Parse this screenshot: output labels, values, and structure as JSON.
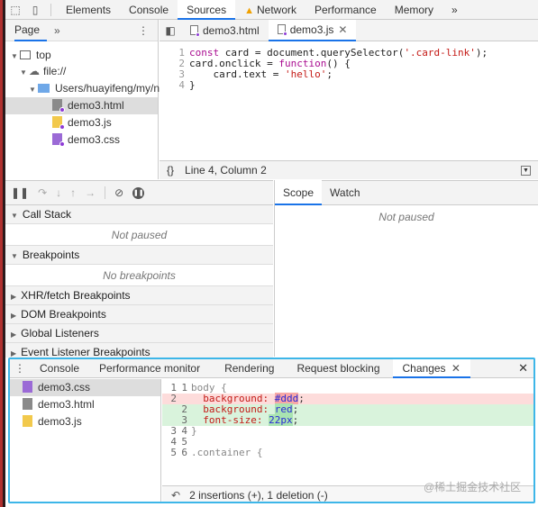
{
  "toolbar": {
    "tabs": [
      {
        "label": "Elements",
        "active": false
      },
      {
        "label": "Console",
        "active": false
      },
      {
        "label": "Sources",
        "active": true
      },
      {
        "label": "Network",
        "active": false,
        "warning": true
      },
      {
        "label": "Performance",
        "active": false
      },
      {
        "label": "Memory",
        "active": false
      }
    ],
    "more": "»"
  },
  "navigator": {
    "tab": "Page",
    "more": "»",
    "tree": {
      "top": "top",
      "origin": "file://",
      "folder": "Users/huayifeng/my/n",
      "files": [
        "demo3.html",
        "demo3.js",
        "demo3.css"
      ]
    }
  },
  "editor": {
    "tabs": [
      {
        "label": "demo3.html",
        "active": false
      },
      {
        "label": "demo3.js",
        "active": true
      }
    ],
    "lines": [
      "1",
      "2",
      "3",
      "4"
    ],
    "status": "Line 4, Column 2",
    "braces": "{}"
  },
  "code": {
    "l1_kw": "const",
    "l1_a": " card = document.querySelector(",
    "l1_str": "'.card-link'",
    "l1_b": ");",
    "l2_a": "card.onclick = ",
    "l2_kw": "function",
    "l2_b": "() {",
    "l3_a": "    card.text = ",
    "l3_str": "'hello'",
    "l3_b": ";",
    "l4": "}"
  },
  "debugger": {
    "call_stack": {
      "title": "Call Stack",
      "body": "Not paused"
    },
    "breakpoints": {
      "title": "Breakpoints",
      "body": "No breakpoints"
    },
    "xhr": "XHR/fetch Breakpoints",
    "dom": "DOM Breakpoints",
    "global": "Global Listeners",
    "event": "Event Listener Breakpoints",
    "scope_tabs": [
      "Scope",
      "Watch"
    ],
    "scope_body": "Not paused"
  },
  "drawer": {
    "tabs": [
      "Console",
      "Performance monitor",
      "Rendering",
      "Request blocking",
      "Changes"
    ],
    "active_tab": "Changes",
    "files": [
      "demo3.css",
      "demo3.html",
      "demo3.js"
    ],
    "diff": {
      "r1": {
        "n1": "1",
        "n2": "1",
        "text": "body {"
      },
      "r2": {
        "n1": "2",
        "n2": "",
        "prop": "background: ",
        "val": "#ddd",
        "end": ";"
      },
      "r3": {
        "n1": "",
        "n2": "2",
        "prop": "background: ",
        "val": "red",
        "end": ";"
      },
      "r4": {
        "n1": "",
        "n2": "3",
        "prop": "font-size: ",
        "val": "22px",
        "end": ";"
      },
      "r5": {
        "n1": "3",
        "n2": "4",
        "text": "}"
      },
      "r6": {
        "n1": "4",
        "n2": "5",
        "text": ""
      },
      "r7": {
        "n1": "5",
        "n2": "6",
        "text": ".container {"
      }
    },
    "status": "2 insertions (+), 1 deletion (-)"
  },
  "watermark": "@稀土掘金技术社区"
}
